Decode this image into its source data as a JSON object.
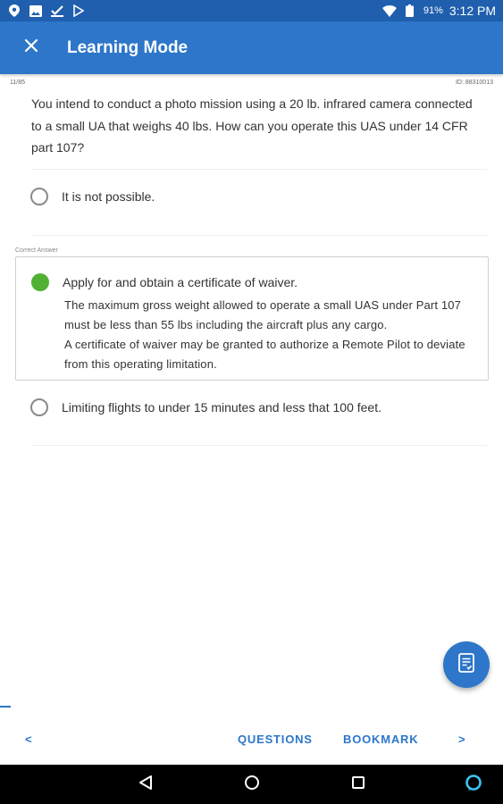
{
  "status_bar": {
    "battery_percent": "91%",
    "time": "3:12 PM",
    "icons": [
      "location-icon",
      "image-icon",
      "check-icon",
      "play-store-icon",
      "wifi-icon",
      "battery-icon"
    ]
  },
  "app_bar": {
    "title": "Learning Mode",
    "close_icon": "close-icon"
  },
  "question": {
    "counter": "11/85",
    "id_label": "ID: 88310013",
    "text": "You intend to conduct a photo mission using a 20 lb. infrared camera connected to a small UA that weighs 40 lbs. How can you operate this UAS under 14 CFR part 107?"
  },
  "options": [
    {
      "label": "It is not possible.",
      "selected": false
    },
    {
      "label": "Apply for and obtain a certificate of waiver.",
      "selected": true
    },
    {
      "label": "Limiting flights to under 15 minutes and less that 100 feet.",
      "selected": false
    }
  ],
  "correct_answer": {
    "label": "Correct Answer",
    "explanation_1": "The maximum gross weight allowed to operate a small UAS under Part 107 must be less than 55 lbs including the aircraft plus any cargo.",
    "explanation_2": "A certificate of waiver may be granted to authorize a Remote Pilot to deviate from this operating limitation."
  },
  "fab": {
    "icon": "notes-icon"
  },
  "bottom_nav": {
    "prev": "<",
    "questions": "QUESTIONS",
    "bookmark": "BOOKMARK",
    "next": ">"
  },
  "colors": {
    "primary": "#2d76c9",
    "status_bar": "#1f5fae",
    "correct": "#52b035"
  }
}
